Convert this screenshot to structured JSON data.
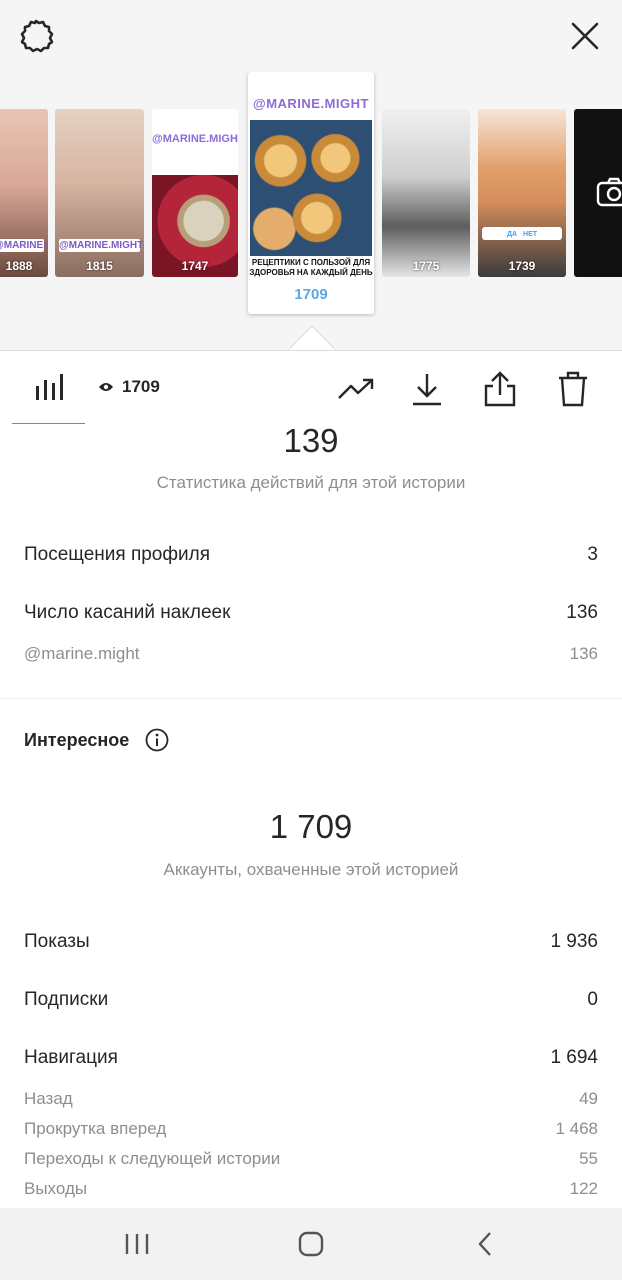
{
  "top": {
    "thumbnails": [
      {
        "views": "1888",
        "tag": "@MARINE.MIGHT"
      },
      {
        "views": "1815",
        "tag": "@MARINE.MIGHT"
      },
      {
        "views": "1747",
        "title": "@MARINE.MIGHT"
      },
      {
        "views": "1709",
        "title": "@MARINE.MIGHT",
        "caption": "РЕЦЕПТИКИ С ПОЛЬЗОЙ ДЛЯ ЗДОРОВЬЯ НА КАЖДЫЙ ДЕНЬ"
      },
      {
        "views": "1775"
      },
      {
        "views": "1739",
        "poll_yes": "ДА",
        "poll_no": "НЕТ"
      }
    ]
  },
  "toolbar": {
    "view_count": "1709"
  },
  "interactions": {
    "total": "139",
    "subtitle": "Статистика действий для этой истории",
    "rows": [
      {
        "label": "Посещения профиля",
        "value": "3"
      },
      {
        "label": "Число касаний наклеек",
        "value": "136"
      }
    ],
    "sticker_mention": {
      "label": "@marine.might",
      "value": "136"
    }
  },
  "discovery": {
    "title": "Интересное",
    "reach": "1 709",
    "reach_subtitle": "Аккаунты, охваченные этой историей",
    "rows": [
      {
        "label": "Показы",
        "value": "1 936"
      },
      {
        "label": "Подписки",
        "value": "0"
      },
      {
        "label": "Навигация",
        "value": "1 694"
      }
    ],
    "navigation_details": [
      {
        "label": "Назад",
        "value": "49"
      },
      {
        "label": "Прокрутка вперед",
        "value": "1 468"
      },
      {
        "label": "Переходы к следующей истории",
        "value": "55"
      },
      {
        "label": "Выходы",
        "value": "122"
      }
    ]
  },
  "colors": {
    "accent": "#3897f0",
    "text": "#262626",
    "muted": "#8e8e8e",
    "brand_purple": "#8b6bd8"
  }
}
